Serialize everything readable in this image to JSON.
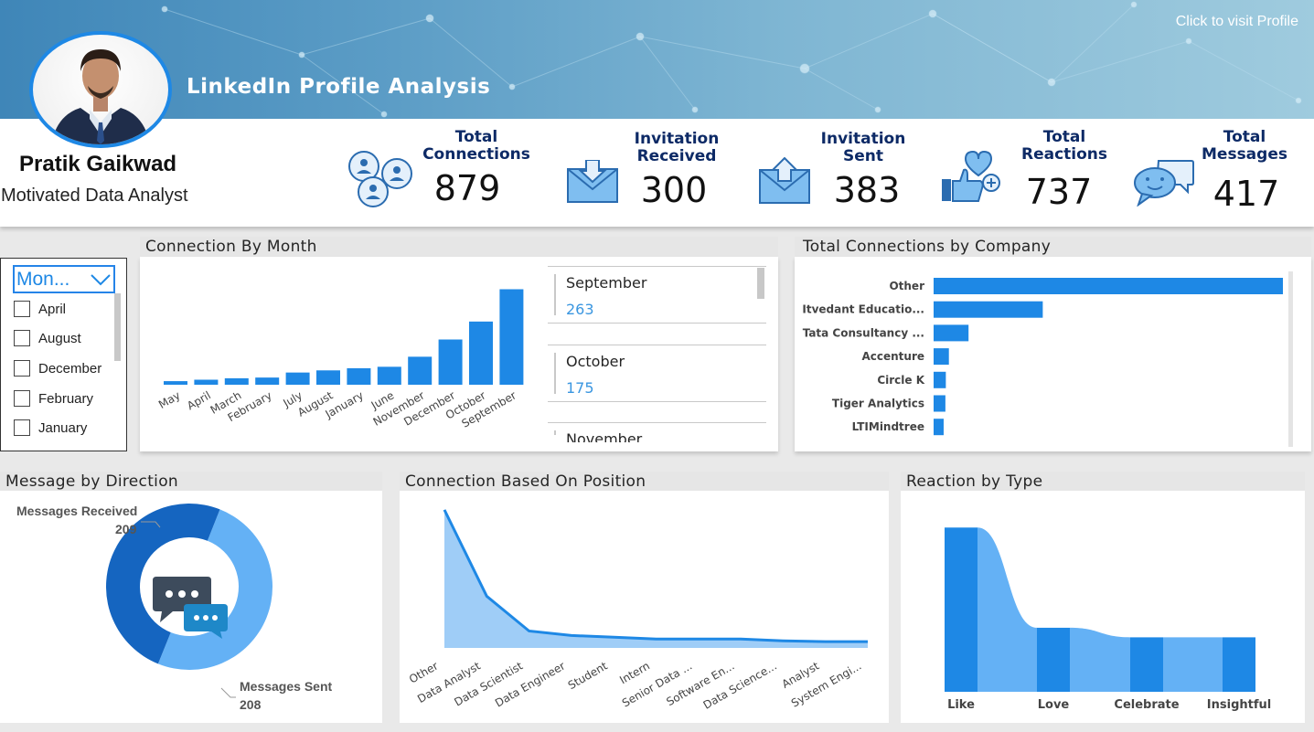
{
  "header": {
    "title": "LinkedIn Profile Analysis",
    "visit_link": "Click to visit Profile"
  },
  "profile": {
    "name": "Pratik Gaikwad",
    "role": "Motivated Data Analyst"
  },
  "kpis": [
    {
      "label": "Total\nConnections",
      "value": "879",
      "icon": "people-network-icon"
    },
    {
      "label": "Invitation\nReceived",
      "value": "300",
      "icon": "envelope-down-icon"
    },
    {
      "label": "Invitation\nSent",
      "value": "383",
      "icon": "envelope-up-icon"
    },
    {
      "label": "Total\nReactions",
      "value": "737",
      "icon": "thumbs-up-heart-icon"
    },
    {
      "label": "Total\nMessages",
      "value": "417",
      "icon": "chat-bubbles-icon"
    }
  ],
  "slicer": {
    "header": "Mon...",
    "items": [
      "April",
      "August",
      "December",
      "February",
      "January"
    ]
  },
  "month_chart": {
    "title": "Connection By Month"
  },
  "month_cards": [
    {
      "month": "September",
      "value": "263"
    },
    {
      "month": "October",
      "value": "175"
    },
    {
      "month": "November",
      "value": ""
    }
  ],
  "company_chart": {
    "title": "Total Connections by Company"
  },
  "message_chart": {
    "title": "Message by Direction",
    "received_label": "Messages Received",
    "received_value": "209",
    "sent_label": "Messages Sent",
    "sent_value": "208"
  },
  "position_chart": {
    "title": "Connection Based On Position"
  },
  "reaction_chart": {
    "title": "Reaction by Type"
  },
  "colors": {
    "accent": "#1e88e5",
    "light_accent": "#64b1f5",
    "dark_accent": "#1565c0",
    "kpi_label": "#0d2a66"
  },
  "chart_data": [
    {
      "type": "bar",
      "title": "Connection By Month",
      "categories": [
        "May",
        "April",
        "March",
        "February",
        "July",
        "August",
        "January",
        "June",
        "November",
        "December",
        "October",
        "September"
      ],
      "values": [
        5,
        7,
        9,
        10,
        17,
        20,
        23,
        25,
        39,
        63,
        88,
        133
      ],
      "ylim": [
        0,
        140
      ]
    },
    {
      "type": "bar",
      "orientation": "horizontal",
      "title": "Total Connections by Company",
      "categories": [
        "Other",
        "Itvedant Educatio...",
        "Tata Consultancy ...",
        "Accenture",
        "Circle K",
        "Tiger Analytics",
        "LTIMindtree"
      ],
      "values": [
        800,
        250,
        80,
        35,
        28,
        27,
        23
      ],
      "xlim": [
        0,
        800
      ]
    },
    {
      "type": "pie",
      "title": "Message by Direction",
      "categories": [
        "Messages Received",
        "Messages Sent"
      ],
      "values": [
        209,
        208
      ]
    },
    {
      "type": "area",
      "title": "Connection Based On Position",
      "categories": [
        "Other",
        "Data Analyst",
        "Data Scientist",
        "Data Engineer",
        "Student",
        "Intern",
        "Senior Data ...",
        "Software En...",
        "Data Science...",
        "Analyst",
        "System Engi..."
      ],
      "values": [
        155,
        58,
        19,
        14,
        12,
        10,
        10,
        10,
        8,
        7,
        7
      ],
      "ylim": [
        0,
        160
      ]
    },
    {
      "type": "bar",
      "subtype": "ribbon",
      "title": "Reaction by Type",
      "categories": [
        "Like",
        "Love",
        "Celebrate",
        "Insightful"
      ],
      "values": [
        395,
        154,
        131,
        131
      ],
      "ylim": [
        0,
        400
      ]
    }
  ]
}
